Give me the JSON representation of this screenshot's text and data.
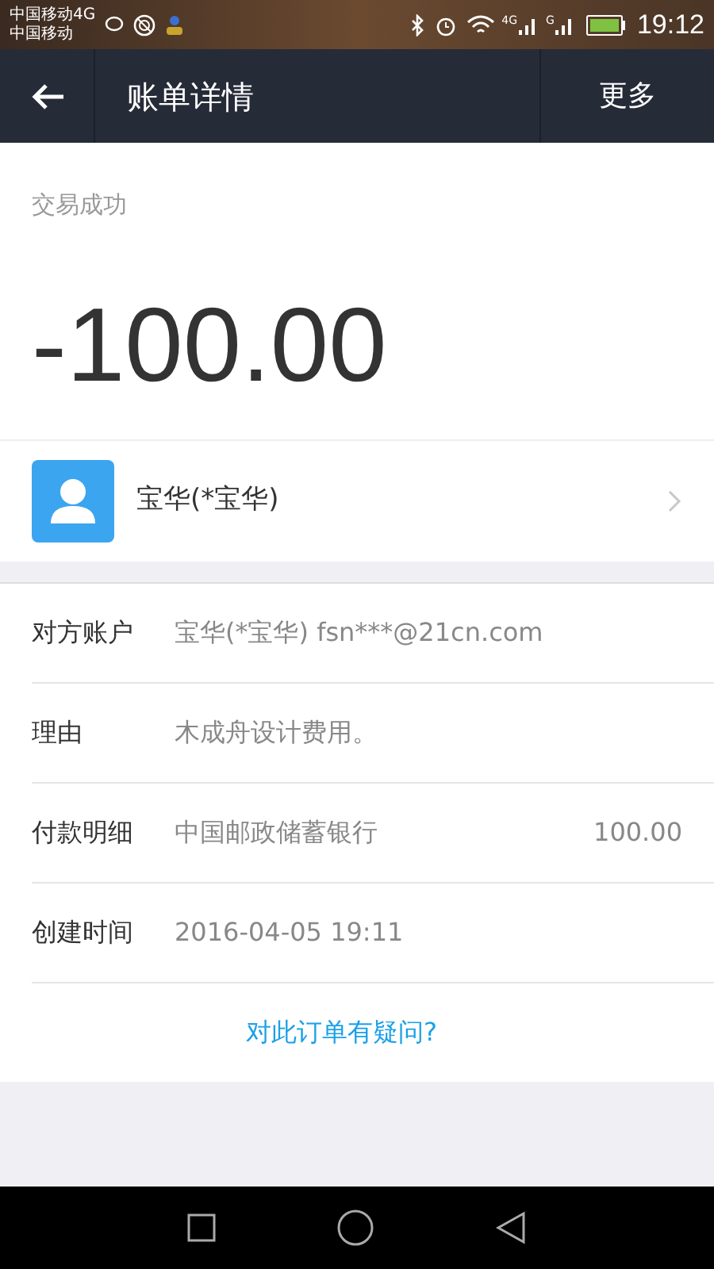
{
  "status_bar": {
    "carrier_lines": [
      "中国移动4G",
      "中国移动"
    ],
    "signal_labels": [
      "4G",
      "G"
    ],
    "time": "19:12"
  },
  "header": {
    "title": "账单详情",
    "more": "更多"
  },
  "transaction": {
    "status": "交易成功",
    "amount": "-100.00"
  },
  "contact": {
    "name": "宝华(*宝华)"
  },
  "details": [
    {
      "kind": "text",
      "label": "对方账户",
      "value": "宝华(*宝华) fsn***@21cn.com"
    },
    {
      "kind": "text",
      "label": "理由",
      "value": "木成舟设计费用。"
    },
    {
      "kind": "amount",
      "label": "付款明细",
      "value": "中国邮政储蓄银行",
      "amount": "100.00"
    },
    {
      "kind": "text",
      "label": "创建时间",
      "value": "2016-04-05 19:11"
    }
  ],
  "question_link": "对此订单有疑问?"
}
